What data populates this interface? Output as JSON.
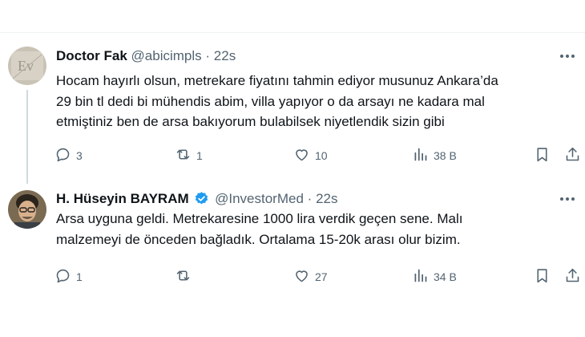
{
  "tweets": [
    {
      "name": "Doctor Fak",
      "handle": "@abicimpls",
      "separator": "·",
      "time": "22s",
      "verified": false,
      "text": "Hocam hayırlı olsun, metrekare fiyatını tahmin ediyor musunuz Ankara’da\n29 bin tl dedi bi mühendis abim, villa yapıyor o da arsayı ne kadara mal\netmiştiniz ben de arsa bakıyorum bulabilsek niyetlendik sizin gibi",
      "replies": "3",
      "reposts": "1",
      "likes": "10",
      "views": "38 B"
    },
    {
      "name": "H. Hüseyin BAYRAM",
      "handle": "@InvestorMed",
      "separator": "·",
      "time": "22s",
      "verified": true,
      "text": "Arsa uyguna geldi. Metrekaresine 1000 lira verdik geçen sene. Malı\nmalzemeyi de önceden bağladık. Ortalama 15-20k arası olur bizim.",
      "replies": "1",
      "reposts": "",
      "likes": "27",
      "views": "34 B"
    }
  ],
  "colors": {
    "text": "#0f1419",
    "secondary": "#536471",
    "verified": "#1d9bf0",
    "divider": "#eff3f4"
  },
  "icons": [
    "reply-icon",
    "repost-icon",
    "like-icon",
    "views-icon",
    "bookmark-icon",
    "share-icon",
    "more-icon",
    "verified-badge-icon"
  ]
}
